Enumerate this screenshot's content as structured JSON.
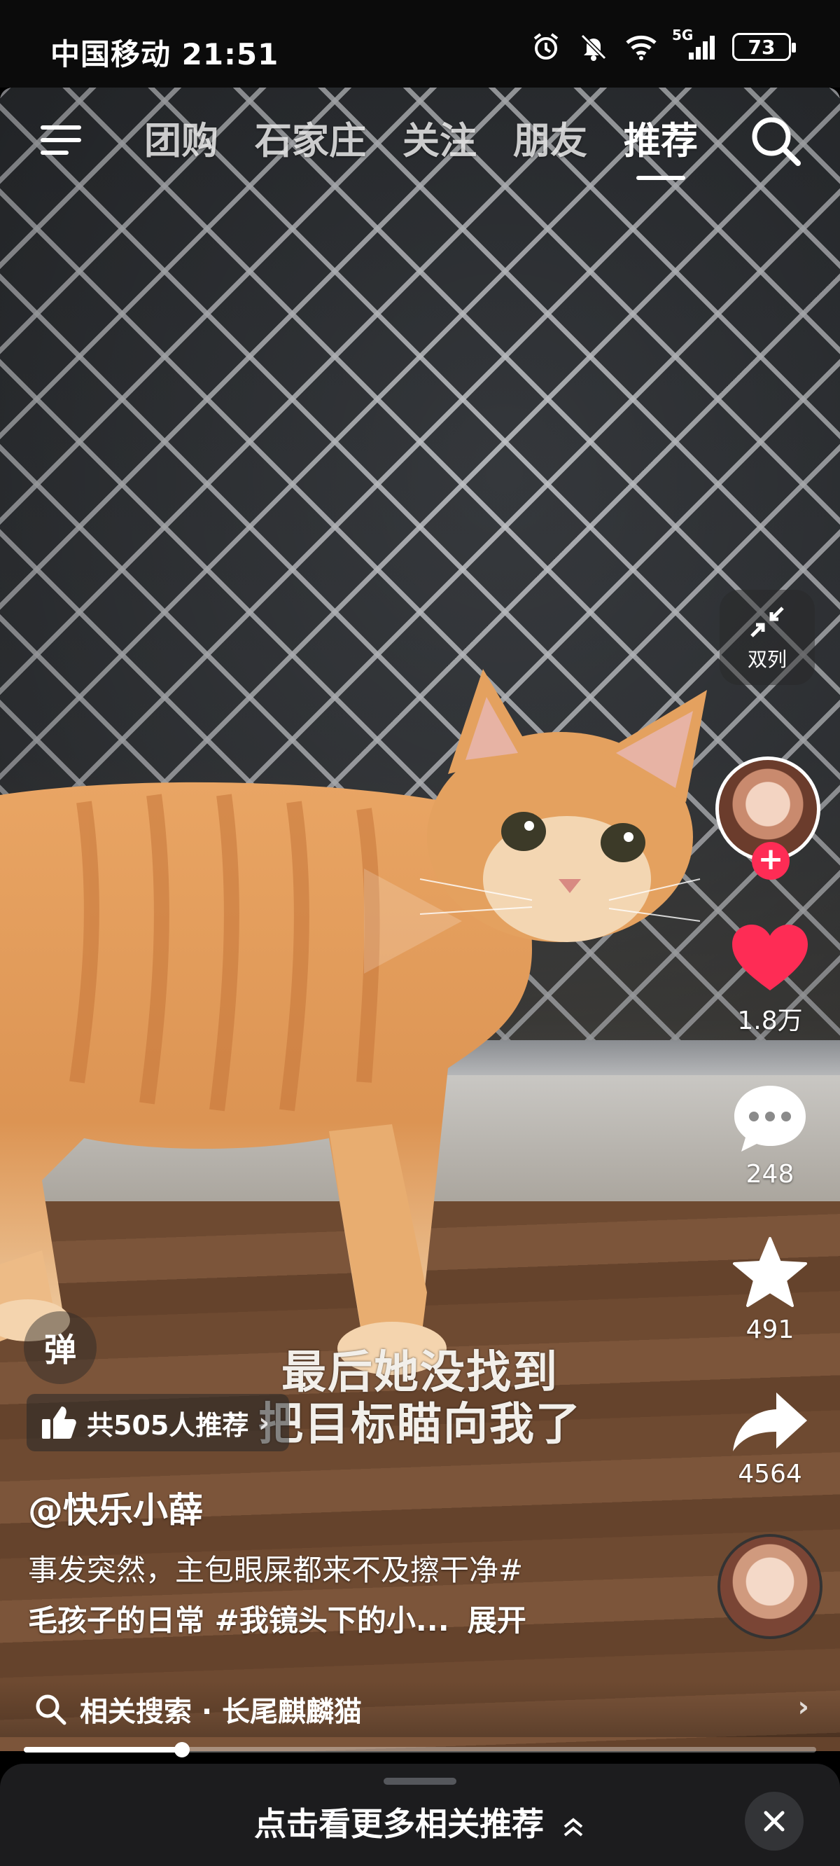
{
  "status_bar": {
    "carrier_time": "中国移动 21:51",
    "network": "5G",
    "battery": "73"
  },
  "top_nav": {
    "tabs": [
      {
        "label": "团购"
      },
      {
        "label": "石家庄"
      },
      {
        "label": "关注"
      },
      {
        "label": "朋友"
      },
      {
        "label": "推荐"
      }
    ],
    "active_tab": "推荐"
  },
  "right_actions": {
    "dual_column_label": "双列",
    "like_count": "1.8万",
    "comment_count": "248",
    "favorite_count": "491",
    "share_count": "4564",
    "like_color": "#fe2c55"
  },
  "video": {
    "subtitle_line1": "最后她没找到",
    "subtitle_line2": "把目标瞄向我了",
    "danmu_label": "弹",
    "recommend_badge": "共505人推荐",
    "author": "@快乐小薛",
    "desc_text": "事发突然，主包眼屎都来不及擦干净#",
    "desc_tags": "毛孩子的日常 #我镜头下的小...",
    "expand_label": "展开",
    "related_search": "相关搜索 · 长尾麒麟猫",
    "progress": 0.2
  },
  "bottom_panel": {
    "more_recommend": "点击看更多相关推荐"
  },
  "colors": {
    "accent": "#fe2c55",
    "panel": "#1c1c1e"
  }
}
